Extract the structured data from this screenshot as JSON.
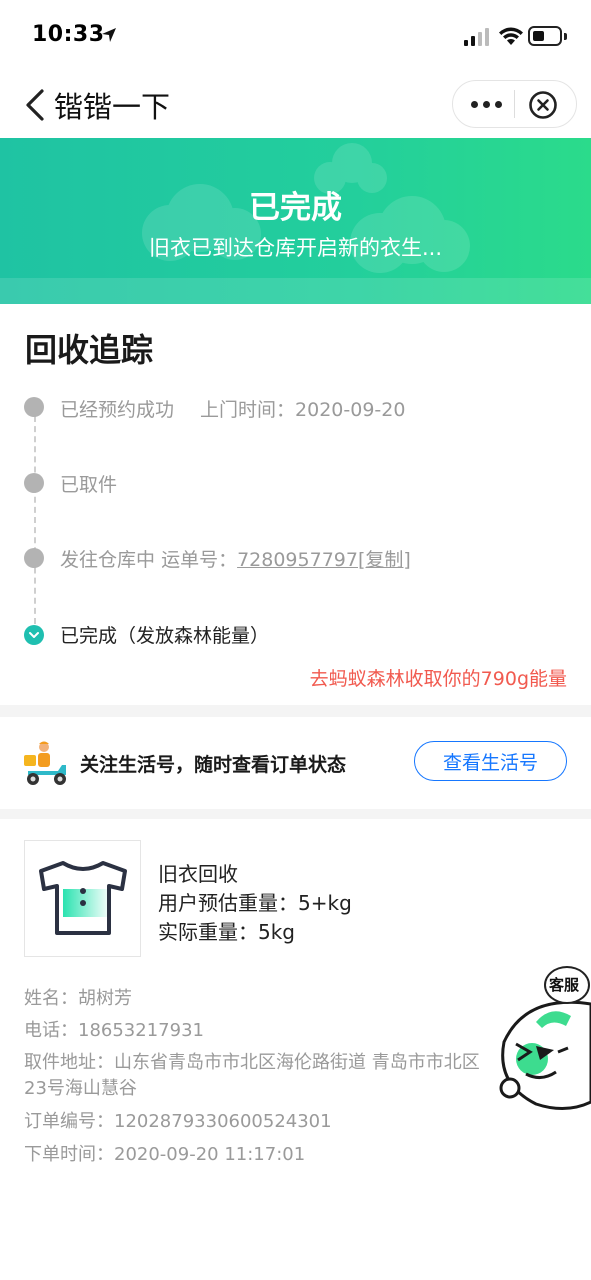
{
  "status_bar": {
    "time": "10:33"
  },
  "nav": {
    "title": "锴锴一下"
  },
  "banner": {
    "title": "已完成",
    "subtitle": "旧衣已到达仓库开启新的衣生..."
  },
  "tracking": {
    "title": "回收追踪",
    "steps": [
      {
        "label": "已经预约成功",
        "time_label": "上门时间：2020-09-20"
      },
      {
        "label": "已取件"
      },
      {
        "label": "发往仓库中",
        "waybill_prefix": "运单号：",
        "waybill_number": "7280957797",
        "copy_label": "[复制]"
      },
      {
        "label": "已完成（发放森林能量）"
      }
    ],
    "energy_link": "去蚂蚁森林收取你的790g能量"
  },
  "follow": {
    "text": "关注生活号，随时查看订单状态",
    "button_label": "查看生活号"
  },
  "product": {
    "name": "旧衣回收",
    "estimated_weight": "用户预估重量：5+kg",
    "actual_weight": "实际重量：5kg"
  },
  "order_info": {
    "name": "姓名：胡树芳",
    "phone": "电话：18653217931",
    "address_line1": "取件地址：山东省青岛市市北区海伦路街道 青岛市市北区",
    "address_line2": "23号海山慧谷",
    "order_number": "订单编号：1202879330600524301",
    "order_time": "下单时间：2020-09-20 11:17:01"
  },
  "customer_service": {
    "label": "客服"
  },
  "colors": {
    "banner_start": "#1fc3a3",
    "banner_end": "#2bdb8b",
    "accent_blue": "#1677ff",
    "energy_red": "#f15a4f",
    "done_teal": "#1fbfb0"
  }
}
